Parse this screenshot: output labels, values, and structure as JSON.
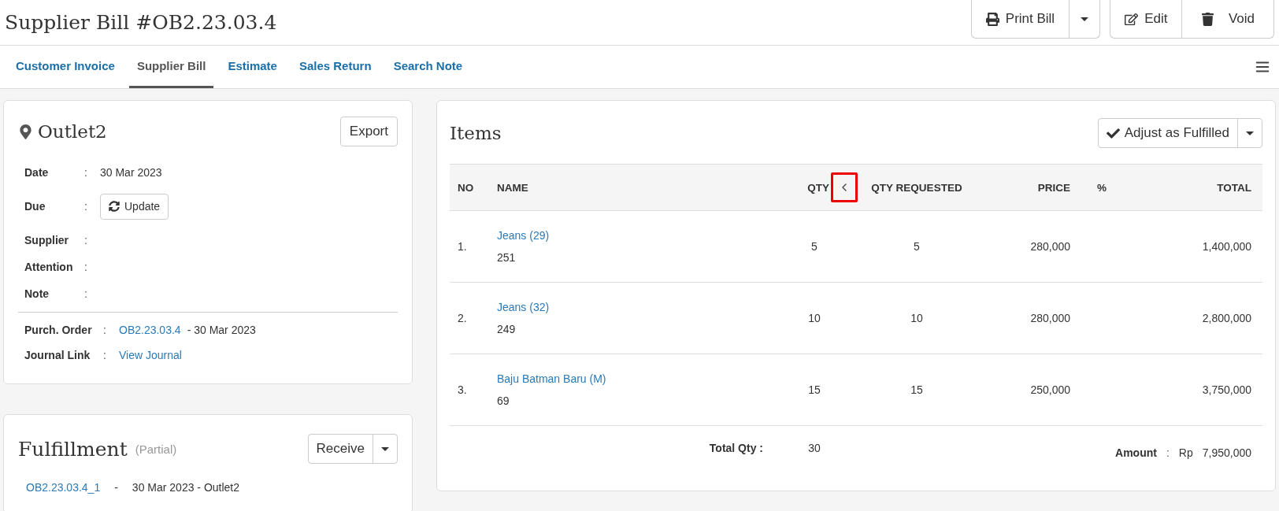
{
  "title": "Supplier Bill #OB2.23.03.4",
  "header_buttons": [
    {
      "kind": "split",
      "label": "Print Bill"
    },
    {
      "kind": "edit",
      "label": "Edit"
    },
    {
      "kind": "void",
      "label": "Void"
    }
  ],
  "tabs": [
    {
      "label": "Customer Invoice",
      "selected": false
    },
    {
      "label": "Supplier Bill",
      "selected": true
    },
    {
      "label": "Estimate",
      "selected": false
    },
    {
      "label": "Sales Return",
      "selected": false
    },
    {
      "label": "Search Note",
      "selected": false
    }
  ],
  "location": {
    "name": "Outlet2",
    "export_label": "Export",
    "fields": [
      {
        "label": "Date",
        "colon": ":",
        "kind": "text",
        "value": "30 Mar 2023"
      },
      {
        "label": "Due",
        "colon": ":",
        "kind": "button",
        "value": "Update"
      },
      {
        "label": "Supplier",
        "colon": ":",
        "kind": "text"
      },
      {
        "label": "Attention",
        "colon": ":",
        "kind": "text"
      },
      {
        "label": "Note",
        "colon": ":",
        "kind": "text"
      }
    ],
    "links": [
      {
        "label": "Purch. Order",
        "colon": ":",
        "value": "OB2.23.03.4",
        "suffix": "- 30 Mar 2023"
      },
      {
        "label": "Journal Link",
        "colon": ":",
        "value": "View Journal"
      }
    ]
  },
  "fulfillment": {
    "title": "Fulfillment",
    "status": "(Partial)",
    "button": "Receive",
    "entries": [
      {
        "code": "OB2.23.03.4_1",
        "separator": "-",
        "detail": "30 Mar 2023 - Outlet2"
      }
    ]
  },
  "items": {
    "title": "Items",
    "button": "Adjust as Fulfilled",
    "columns": [
      "NO",
      "NAME",
      "QTY",
      "QTY REQUESTED",
      "PRICE",
      "%",
      "TOTAL"
    ],
    "qty_toggle": {
      "highlighted": true
    },
    "rows": [
      {
        "no": "1.",
        "name": "Jeans (29)",
        "code": "251",
        "qty": "5",
        "qty_requested": "5",
        "price": "280,000",
        "total": "1,400,000"
      },
      {
        "no": "2.",
        "name": "Jeans (32)",
        "code": "249",
        "qty": "10",
        "qty_requested": "10",
        "price": "280,000",
        "total": "2,800,000"
      },
      {
        "no": "3.",
        "name": "Baju Batman Baru (M)",
        "code": "69",
        "qty": "15",
        "qty_requested": "15",
        "price": "250,000",
        "total": "3,750,000"
      }
    ],
    "total_qty_label": "Total Qty :",
    "total_qty": "30",
    "amount_label": "Amount",
    "amount_colon": ":",
    "currency": "Rp",
    "amount": "7,950,000"
  }
}
